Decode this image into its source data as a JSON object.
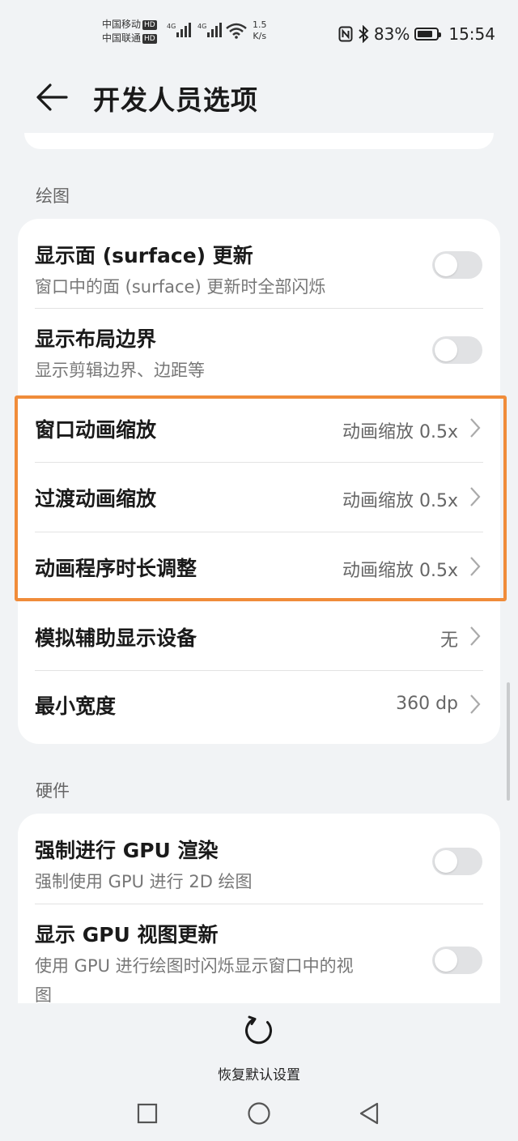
{
  "status_bar": {
    "carrier1": "中国移动",
    "carrier2": "中国联通",
    "hd_badge": "HD",
    "network1": "4G",
    "network2": "4G",
    "speed_value": "1.5",
    "speed_unit": "K/s",
    "battery": "83%",
    "battery_level": 0.83,
    "time": "15:54",
    "icons": [
      "nfc-icon",
      "bluetooth-icon",
      "wifi-icon",
      "signal-icon",
      "battery-icon"
    ]
  },
  "header": {
    "title": "开发人员选项",
    "back_icon": "back-arrow-icon"
  },
  "sections": {
    "drawing": {
      "label": "绘图",
      "show_surface_updates": {
        "title": "显示面 (surface) 更新",
        "subtitle": "窗口中的面 (surface) 更新时全部闪烁",
        "enabled": false
      },
      "show_layout_bounds": {
        "title": "显示布局边界",
        "subtitle": "显示剪辑边界、边距等",
        "enabled": false
      },
      "window_animation_scale": {
        "title": "窗口动画缩放",
        "value": "动画缩放 0.5x"
      },
      "transition_animation_scale": {
        "title": "过渡动画缩放",
        "value": "动画缩放 0.5x"
      },
      "animator_duration_scale": {
        "title": "动画程序时长调整",
        "value": "动画缩放 0.5x"
      },
      "simulate_secondary_displays": {
        "title": "模拟辅助显示设备",
        "value": "无"
      },
      "smallest_width": {
        "title": "最小宽度",
        "value": "360 dp"
      }
    },
    "hardware": {
      "label": "硬件",
      "force_gpu_rendering": {
        "title": "强制进行 GPU 渲染",
        "subtitle": "强制使用 GPU 进行 2D 绘图",
        "enabled": false
      },
      "show_gpu_view_updates": {
        "title": "显示 GPU 视图更新",
        "subtitle_line1": "使用 GPU 进行绘图时闪烁显示窗口中的视",
        "subtitle_line2": "图",
        "enabled": false
      }
    }
  },
  "bottom": {
    "reset_label": "恢复默认设置",
    "reset_icon": "refresh-icon"
  },
  "nav": {
    "recents_icon": "square-icon",
    "home_icon": "circle-icon",
    "back_icon": "triangle-back-icon"
  },
  "colors": {
    "highlight": "#f08c3a",
    "background": "#f1f3f5",
    "card": "#ffffff"
  }
}
